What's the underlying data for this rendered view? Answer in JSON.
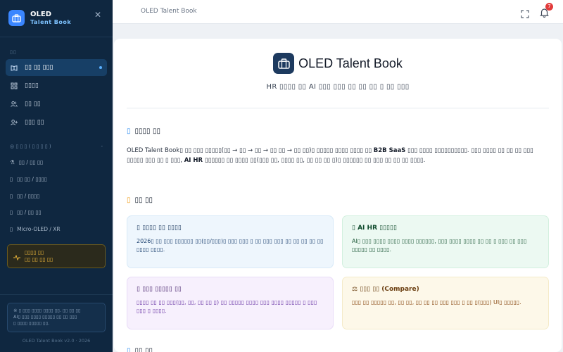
{
  "app": {
    "name": "OLED",
    "sub": "Talent Book"
  },
  "sidebar": {
    "section_label": "▯▯",
    "items": [
      {
        "label": "▯▯ ▯▯ ▯▯▯",
        "icon": "book-icon",
        "active": true
      },
      {
        "label": "▯▯▯▯",
        "icon": "grid-icon",
        "active": false
      },
      {
        "label": "▯▯ ▯▯",
        "icon": "users-icon",
        "active": false
      },
      {
        "label": "▯▯▯ ▯▯",
        "icon": "user-plus-icon",
        "active": false
      }
    ],
    "category_header": "▯ ▯ ▯ ( ▯ ▯ ▯ ▯ )",
    "category_toggle": "-",
    "sub_items": [
      {
        "label": "▯▯ / ▯▯ ▯▯",
        "icon": "flask-icon"
      },
      {
        "label": "▯▯ ▯▯ / ▯▯▯▯",
        "icon": "box-icon"
      },
      {
        "label": "▯▯ / ▯▯▯▯",
        "icon": "box-icon"
      },
      {
        "label": "▯▯ / ▯▯ ▯▯",
        "icon": "box-icon"
      },
      {
        "label": "Micro-OLED / XR",
        "icon": "box-icon"
      }
    ],
    "warning": {
      "line1": "▯▯▯▯ ▯▯",
      "line2": "▯▯ ▯▯ ▯▯ ▯▯"
    },
    "info": {
      "line1": "※ ▯ ▯▯▯ ▯▯▯▯ ▯▯▯▯ ▯▯. ▯▯ ▯▯ ▯▯",
      "line2": "AI▯ ▯▯▯ ▯▯▯▯ ▯▯▯▯▯ ▯▯ ▯▯ ▯▯▯",
      "line3": "▯ ▯▯▯▯ ▯▯▯▯▯ ▯▯."
    },
    "footer": "OLED Talent Book v2.0 · 2026"
  },
  "topbar": {
    "title": "OLED Talent Book",
    "notifications": "7"
  },
  "main": {
    "title": "OLED Talent Book",
    "subtitle": "HR ▯▯▯▯ ▯▯ AI ▯▯▯ ▯▯▯ ▯▯ ▯▯ ▯▯ ▯ ▯▯ ▯▯▯",
    "section1": {
      "icon": "▯",
      "title": "▯▯▯▯ ▯▯"
    },
    "intro": {
      "part1": "OLED Talent Book▯ ▯▯ ▯▯▯ ▯▯▯▯▯(▯▯ → ▯▯ → ▯▯ → ▯▯ ▯▯ → ▯▯ ▯▯)▯ ▯▯▯▯▯ ▯▯▯▯ ▯▯▯▯ ▯▯ ",
      "bold1": "B2B SaaS",
      "part2": " ▯▯▯ ▯▯▯▯ ▯▯▯▯▯▯▯▯▯▯. ▯▯▯ ▯▯▯▯ ▯▯ ▯▯ ▯▯ ▯▯▯ ▯▯▯▯▯ ▯▯▯ ▯▯ ▯ ▯▯▯, ",
      "bold2": "AI HR ▯▯▯▯▯",
      "part3": "▯ ▯▯ ▯▯▯▯ ▯▯(▯▯▯ ▯▯, ▯▯▯▯ ▯▯, ▯▯ ▯▯ ▯▯ ▯)▯ ▯▯▯▯▯▯ ▯▯ ▯▯▯ ▯▯ ▯▯ ▯▯ ▯▯▯▯."
    },
    "section2": {
      "icon": "▯",
      "title": "▯▯ ▯▯"
    },
    "features": [
      {
        "title": "▯ ▯▯▯▯ ▯▯ ▯▯▯▯",
        "desc": "2026▯ ▯▯ ▯▯▯ ▯▯▯▯▯▯ ▯▯(▯▯/▯▯▯)▯ ▯▯▯ ▯▯▯ ▯ ▯▯ ▯▯▯ ▯▯▯ ▯▯ ▯▯ ▯▯ ▯▯ ▯▯ ▯▯▯▯ ▯▯▯▯."
      },
      {
        "title": "▯ AI HR ▯▯▯▯▯",
        "desc": "AI▯ ▯▯▯ ▯▯▯▯ ▯▯▯▯ ▯▯▯▯ ▯▯▯▯▯▯, ▯▯▯ ▯▯▯▯ ▯▯▯▯ ▯▯ ▯▯ ▯ ▯▯▯ ▯▯ ▯▯▯ ▯▯▯▯▯ ▯▯ ▯▯▯▯."
      },
      {
        "title": "▯ ▯▯▯ ▯▯▯▯▯ ▯▯",
        "desc": "▯▯▯▯ ▯▯ ▯▯ ▯▯▯(▯▯, ▯▯, ▯▯ ▯▯ ▯) ▯▯ ▯▯▯▯▯ ▯▯▯▯ ▯▯▯ ▯▯▯▯ ▯▯▯▯▯ ▯ ▯▯▯ ▯▯▯ ▯ ▯▯▯▯."
      },
      {
        "title": "⚖ ▯▯▯ ▯▯ (Compare)",
        "desc": "▯▯▯ ▯▯ ▯▯▯▯▯ ▯▯, ▯▯ ▯▯, ▯▯ ▯▯ ▯▯ ▯▯▯ ▯▯▯ ▯ ▯▯ ▯(▯▯▯) UI▯ ▯▯▯▯▯."
      }
    ],
    "section3": {
      "icon": "▯",
      "title": "▯▯ ▯▯"
    }
  }
}
